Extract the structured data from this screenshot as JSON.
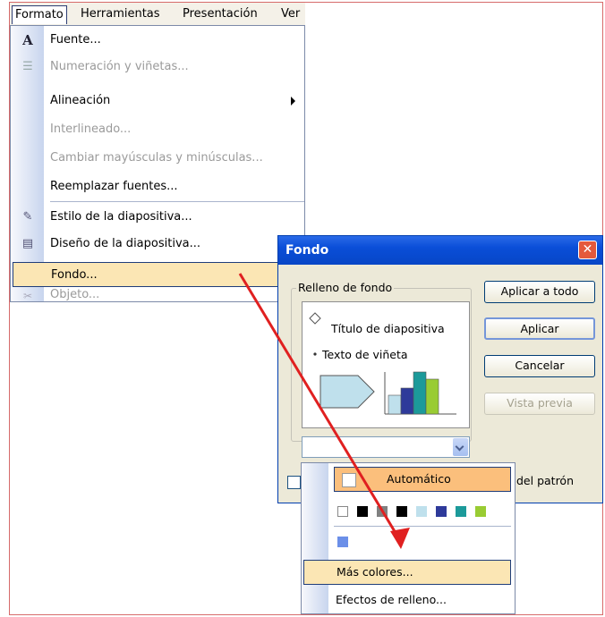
{
  "menubar": {
    "items": [
      "Formato",
      "Herramientas",
      "Presentación",
      "Ver"
    ]
  },
  "menu": {
    "items": [
      {
        "label": "Fuente...",
        "icon": "font-A-icon",
        "disabled": false
      },
      {
        "label": "Numeración y viñetas...",
        "icon": "bullets-icon",
        "disabled": true
      },
      {
        "label": "Alineación",
        "icon": "",
        "disabled": false,
        "submenu": true
      },
      {
        "label": "Interlineado...",
        "icon": "",
        "disabled": true
      },
      {
        "label": "Cambiar mayúsculas y minúsculas...",
        "icon": "",
        "disabled": true
      },
      {
        "label": "Reemplazar fuentes...",
        "icon": "",
        "disabled": false
      },
      {
        "label": "Estilo de la diapositiva...",
        "icon": "slide-style-icon",
        "disabled": false
      },
      {
        "label": "Diseño de la diapositiva...",
        "icon": "slide-layout-icon",
        "disabled": false
      },
      {
        "label": "Fondo...",
        "icon": "",
        "disabled": false,
        "highlighted": true
      },
      {
        "label": "Objeto...",
        "icon": "object-icon",
        "disabled": true
      }
    ]
  },
  "dialog": {
    "title": "Fondo",
    "group_label": "Relleno de fondo",
    "preview_title": "Título de diapositiva",
    "preview_bullet": "Texto de viñeta",
    "buttons": {
      "apply_all": "Aplicar a todo",
      "apply": "Aplicar",
      "cancel": "Cancelar",
      "preview": "Vista previa"
    },
    "checkbox_label": "del patrón"
  },
  "popup": {
    "auto_label": "Automático",
    "more_colors": "Más colores...",
    "fill_effects": "Efectos de relleno...",
    "swatches": [
      "#ffffff",
      "#000000",
      "#808080",
      "#000000",
      "#bfe0ec",
      "#2e3a9a",
      "#1c9a9a",
      "#99cc33"
    ],
    "recent_swatch": "#6b8fe8"
  },
  "colors": {
    "highlight": "#fbe6b4",
    "auto_bg": "#fbbf7c",
    "arrow": "#e02020",
    "title_bar": "#0a4ed8"
  }
}
